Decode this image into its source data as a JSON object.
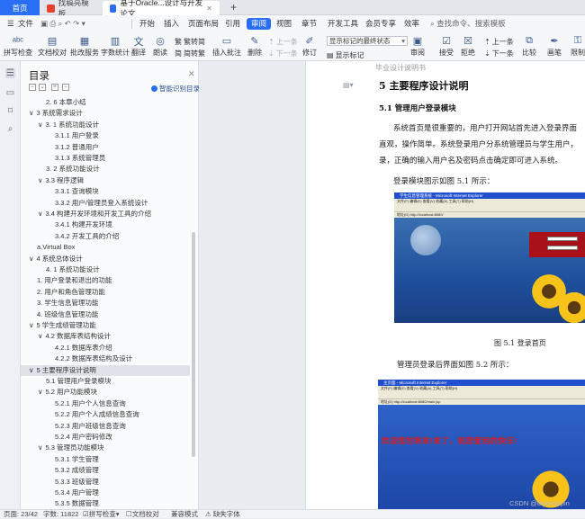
{
  "tabs": [
    {
      "label": "首页",
      "kind": "home"
    },
    {
      "label": "找稿亮模板",
      "icon_color": "#e8412d"
    },
    {
      "label": "基于Oracle...设计与开发 论文",
      "icon_color": "#2a6ef5",
      "active": true
    }
  ],
  "tab_add": "+",
  "menu": {
    "file": "文件",
    "items": [
      "开始",
      "插入",
      "页面布局",
      "引用",
      "审阅",
      "视图",
      "章节",
      "开发工具",
      "会员专享",
      "效率"
    ],
    "active": "审阅",
    "search": "查找命令、搜索模板"
  },
  "ribbon": {
    "spell": "拼写检查",
    "doc_check": "文档校对",
    "batch": "批改服务",
    "wordcount": "字数统计",
    "translate": "翻译",
    "read_aloud": "朗读",
    "trad": "繁转简",
    "simp": "简转繁",
    "insert_comment": "插入批注",
    "delete": "删除",
    "prev": "上一条",
    "next": "下一条",
    "revise": "修订",
    "markup_select": "显示标记的最终状态",
    "show_markup": "显示标记",
    "review": "审阅",
    "accept": "接受",
    "reject": "拒绝",
    "prev2": "上一条",
    "next2": "下一条",
    "compare": "比较",
    "draw": "画笔",
    "restrict": "限制"
  },
  "toc": {
    "title": "目录",
    "smart": "智能识别目录",
    "items": [
      {
        "label": "2. 6  本章小结",
        "level": 2
      },
      {
        "label": "3  系统需求设计",
        "level": 1,
        "arrow": "∨"
      },
      {
        "label": "3. 1  系统功能设计",
        "level": 2,
        "arrow": "∨"
      },
      {
        "label": "3.1.1  用户登录",
        "level": 3
      },
      {
        "label": "3.1.2  普通用户",
        "level": 3
      },
      {
        "label": "3.1.3  系统管理员",
        "level": 3
      },
      {
        "label": "3. 2  系统功能设计",
        "level": 2
      },
      {
        "label": "3.3  程序逻辑",
        "level": 2,
        "arrow": "∨"
      },
      {
        "label": "3.3.1  查询模块",
        "level": 3
      },
      {
        "label": "3.3.2  用户/管理员登入系统设计",
        "level": 3
      },
      {
        "label": "3.4  构建开发环境和开发工具的介绍",
        "level": 2,
        "arrow": "∨"
      },
      {
        "label": "3.4.1 构建开发环境",
        "level": 3
      },
      {
        "label": "3.4.2 开发工具的介绍",
        "level": 3
      },
      {
        "label": "a.Virtual Box",
        "level": 0
      },
      {
        "label": "4  系统总体设计",
        "level": 1,
        "arrow": "∨"
      },
      {
        "label": "4. 1  系统功能设计",
        "level": 2
      },
      {
        "label": "1. 用户登录和退出的功能",
        "level": 0
      },
      {
        "label": "2. 用户和角色管理功能",
        "level": 0
      },
      {
        "label": "3. 学生信息管理功能",
        "level": 0
      },
      {
        "label": "4. 班级信息管理功能",
        "level": 0
      },
      {
        "label": "5 学生成绩管理功能",
        "level": 0,
        "arrow": "∨"
      },
      {
        "label": "4.2  数据库表结构设计",
        "level": 2,
        "arrow": "∨"
      },
      {
        "label": "4.2.1  数据库表介绍",
        "level": 3
      },
      {
        "label": "4.2.2  数据库表结构及设计",
        "level": 3
      },
      {
        "label": "5  主要程序设计说明",
        "level": 1,
        "arrow": "∨",
        "selected": true
      },
      {
        "label": "5.1 管理用户登录模块",
        "level": 2
      },
      {
        "label": "5.2  用户功能模块",
        "level": 2,
        "arrow": "∨"
      },
      {
        "label": "5.2.1  用户个人信息查询",
        "level": 3
      },
      {
        "label": "5.2.2  用户个人成绩信息查询",
        "level": 3
      },
      {
        "label": "5.2.3  用户班级信息查询",
        "level": 3
      },
      {
        "label": "5.2.4  用户密码修改",
        "level": 3
      },
      {
        "label": "5.3  管理员功能模块",
        "level": 2,
        "arrow": "∨"
      },
      {
        "label": "5.3.1  学生管理",
        "level": 3
      },
      {
        "label": "5.3.2  成绩管理",
        "level": 3
      },
      {
        "label": "5.3.3  班级管理",
        "level": 3
      },
      {
        "label": "5.3.4  用户管理",
        "level": 3
      },
      {
        "label": "5.3.5  数据管理",
        "level": 3
      }
    ]
  },
  "doc": {
    "running_header": "毕业设计说明书",
    "heading1": "5   主要程序设计说明",
    "heading2": "5.1 管理用户登录模块",
    "para1_line1": "系统首页是很重要的，用户打开网站首先进入登录界面",
    "para1_line2": "直观，操作简单。系统登录用户分系统管理员与学生用户，",
    "para1_line3": "录，正确的输入用户名及密码点击确定即可进入系统。",
    "para2": "登录模块图示如图 5.1 所示：",
    "fig1_caption": "图 5.1  登录首页",
    "para3": "管理员登录后界面如图 5.2 所示：",
    "fig2_redtext": "欢迎您的到来!来了，祝您使用的快乐!",
    "ie_title": "学生信息管理系统 - Microsoft Internet Explorer",
    "ie_menu": "文件(F)  编辑(E)  查看(V)  收藏(A)  工具(T)  帮助(H)",
    "ie_addr": "地址(D)  http://localhost:8080/",
    "ie_addr2": "地址(D)  http://localhost:8080/main.jsp",
    "ie_title2": "主页面 - Microsoft Internet Explorer"
  },
  "status": {
    "page": "页面: 23/42",
    "words": "字数: 11822",
    "spell": "拼写检查",
    "doccheck": "文档校对",
    "compat": "兼容模式",
    "font": "缺失字体"
  },
  "watermark": "CSDN @biyezuopin",
  "colors": {
    "accent": "#2a6ef5",
    "selected_row": "#dfe3e9"
  }
}
